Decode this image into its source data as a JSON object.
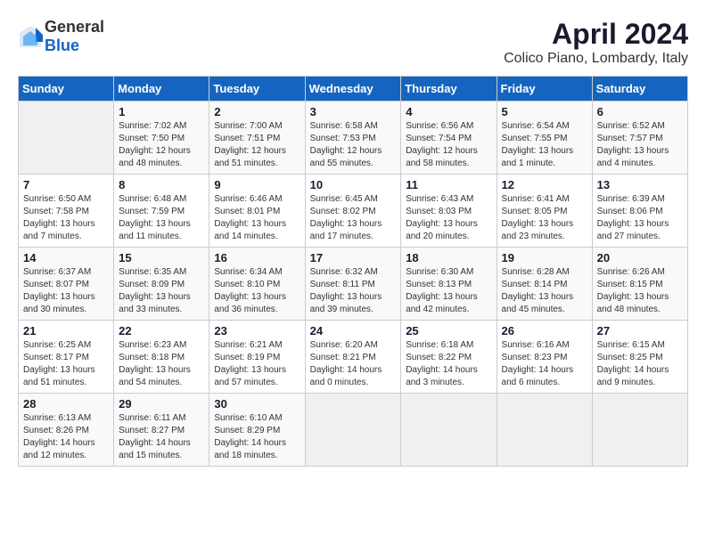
{
  "header": {
    "logo_general": "General",
    "logo_blue": "Blue",
    "title": "April 2024",
    "subtitle": "Colico Piano, Lombardy, Italy"
  },
  "weekdays": [
    "Sunday",
    "Monday",
    "Tuesday",
    "Wednesday",
    "Thursday",
    "Friday",
    "Saturday"
  ],
  "weeks": [
    [
      {
        "day": "",
        "sunrise": "",
        "sunset": "",
        "daylight": ""
      },
      {
        "day": "1",
        "sunrise": "Sunrise: 7:02 AM",
        "sunset": "Sunset: 7:50 PM",
        "daylight": "Daylight: 12 hours and 48 minutes."
      },
      {
        "day": "2",
        "sunrise": "Sunrise: 7:00 AM",
        "sunset": "Sunset: 7:51 PM",
        "daylight": "Daylight: 12 hours and 51 minutes."
      },
      {
        "day": "3",
        "sunrise": "Sunrise: 6:58 AM",
        "sunset": "Sunset: 7:53 PM",
        "daylight": "Daylight: 12 hours and 55 minutes."
      },
      {
        "day": "4",
        "sunrise": "Sunrise: 6:56 AM",
        "sunset": "Sunset: 7:54 PM",
        "daylight": "Daylight: 12 hours and 58 minutes."
      },
      {
        "day": "5",
        "sunrise": "Sunrise: 6:54 AM",
        "sunset": "Sunset: 7:55 PM",
        "daylight": "Daylight: 13 hours and 1 minute."
      },
      {
        "day": "6",
        "sunrise": "Sunrise: 6:52 AM",
        "sunset": "Sunset: 7:57 PM",
        "daylight": "Daylight: 13 hours and 4 minutes."
      }
    ],
    [
      {
        "day": "7",
        "sunrise": "Sunrise: 6:50 AM",
        "sunset": "Sunset: 7:58 PM",
        "daylight": "Daylight: 13 hours and 7 minutes."
      },
      {
        "day": "8",
        "sunrise": "Sunrise: 6:48 AM",
        "sunset": "Sunset: 7:59 PM",
        "daylight": "Daylight: 13 hours and 11 minutes."
      },
      {
        "day": "9",
        "sunrise": "Sunrise: 6:46 AM",
        "sunset": "Sunset: 8:01 PM",
        "daylight": "Daylight: 13 hours and 14 minutes."
      },
      {
        "day": "10",
        "sunrise": "Sunrise: 6:45 AM",
        "sunset": "Sunset: 8:02 PM",
        "daylight": "Daylight: 13 hours and 17 minutes."
      },
      {
        "day": "11",
        "sunrise": "Sunrise: 6:43 AM",
        "sunset": "Sunset: 8:03 PM",
        "daylight": "Daylight: 13 hours and 20 minutes."
      },
      {
        "day": "12",
        "sunrise": "Sunrise: 6:41 AM",
        "sunset": "Sunset: 8:05 PM",
        "daylight": "Daylight: 13 hours and 23 minutes."
      },
      {
        "day": "13",
        "sunrise": "Sunrise: 6:39 AM",
        "sunset": "Sunset: 8:06 PM",
        "daylight": "Daylight: 13 hours and 27 minutes."
      }
    ],
    [
      {
        "day": "14",
        "sunrise": "Sunrise: 6:37 AM",
        "sunset": "Sunset: 8:07 PM",
        "daylight": "Daylight: 13 hours and 30 minutes."
      },
      {
        "day": "15",
        "sunrise": "Sunrise: 6:35 AM",
        "sunset": "Sunset: 8:09 PM",
        "daylight": "Daylight: 13 hours and 33 minutes."
      },
      {
        "day": "16",
        "sunrise": "Sunrise: 6:34 AM",
        "sunset": "Sunset: 8:10 PM",
        "daylight": "Daylight: 13 hours and 36 minutes."
      },
      {
        "day": "17",
        "sunrise": "Sunrise: 6:32 AM",
        "sunset": "Sunset: 8:11 PM",
        "daylight": "Daylight: 13 hours and 39 minutes."
      },
      {
        "day": "18",
        "sunrise": "Sunrise: 6:30 AM",
        "sunset": "Sunset: 8:13 PM",
        "daylight": "Daylight: 13 hours and 42 minutes."
      },
      {
        "day": "19",
        "sunrise": "Sunrise: 6:28 AM",
        "sunset": "Sunset: 8:14 PM",
        "daylight": "Daylight: 13 hours and 45 minutes."
      },
      {
        "day": "20",
        "sunrise": "Sunrise: 6:26 AM",
        "sunset": "Sunset: 8:15 PM",
        "daylight": "Daylight: 13 hours and 48 minutes."
      }
    ],
    [
      {
        "day": "21",
        "sunrise": "Sunrise: 6:25 AM",
        "sunset": "Sunset: 8:17 PM",
        "daylight": "Daylight: 13 hours and 51 minutes."
      },
      {
        "day": "22",
        "sunrise": "Sunrise: 6:23 AM",
        "sunset": "Sunset: 8:18 PM",
        "daylight": "Daylight: 13 hours and 54 minutes."
      },
      {
        "day": "23",
        "sunrise": "Sunrise: 6:21 AM",
        "sunset": "Sunset: 8:19 PM",
        "daylight": "Daylight: 13 hours and 57 minutes."
      },
      {
        "day": "24",
        "sunrise": "Sunrise: 6:20 AM",
        "sunset": "Sunset: 8:21 PM",
        "daylight": "Daylight: 14 hours and 0 minutes."
      },
      {
        "day": "25",
        "sunrise": "Sunrise: 6:18 AM",
        "sunset": "Sunset: 8:22 PM",
        "daylight": "Daylight: 14 hours and 3 minutes."
      },
      {
        "day": "26",
        "sunrise": "Sunrise: 6:16 AM",
        "sunset": "Sunset: 8:23 PM",
        "daylight": "Daylight: 14 hours and 6 minutes."
      },
      {
        "day": "27",
        "sunrise": "Sunrise: 6:15 AM",
        "sunset": "Sunset: 8:25 PM",
        "daylight": "Daylight: 14 hours and 9 minutes."
      }
    ],
    [
      {
        "day": "28",
        "sunrise": "Sunrise: 6:13 AM",
        "sunset": "Sunset: 8:26 PM",
        "daylight": "Daylight: 14 hours and 12 minutes."
      },
      {
        "day": "29",
        "sunrise": "Sunrise: 6:11 AM",
        "sunset": "Sunset: 8:27 PM",
        "daylight": "Daylight: 14 hours and 15 minutes."
      },
      {
        "day": "30",
        "sunrise": "Sunrise: 6:10 AM",
        "sunset": "Sunset: 8:29 PM",
        "daylight": "Daylight: 14 hours and 18 minutes."
      },
      {
        "day": "",
        "sunrise": "",
        "sunset": "",
        "daylight": ""
      },
      {
        "day": "",
        "sunrise": "",
        "sunset": "",
        "daylight": ""
      },
      {
        "day": "",
        "sunrise": "",
        "sunset": "",
        "daylight": ""
      },
      {
        "day": "",
        "sunrise": "",
        "sunset": "",
        "daylight": ""
      }
    ]
  ]
}
